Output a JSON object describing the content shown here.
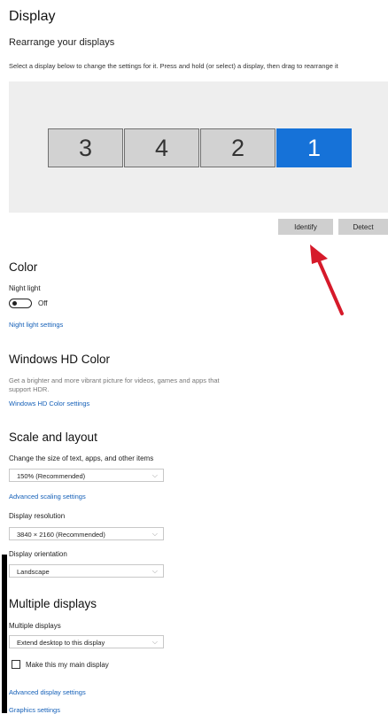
{
  "display": {
    "title": "Display",
    "rearrange_title": "Rearrange your displays",
    "instruction": "Select a display below to change the settings for it. Press and hold (or select) a display, then drag to rearrange it",
    "monitors": [
      "3",
      "4",
      "2",
      "1"
    ],
    "selected_monitor": "1",
    "identify_label": "Identify",
    "detect_label": "Detect"
  },
  "color": {
    "title": "Color",
    "night_light_label": "Night light",
    "night_light_state": "Off",
    "night_light_settings_link": "Night light settings"
  },
  "hd_color": {
    "title": "Windows HD Color",
    "description_line1": "Get a brighter and more vibrant picture for videos, games and apps that",
    "description_line2": "support HDR.",
    "settings_link": "Windows HD Color settings"
  },
  "scale": {
    "title": "Scale and layout",
    "size_label": "Change the size of text, apps, and other items",
    "size_value": "150% (Recommended)",
    "advanced_scaling_link": "Advanced scaling settings",
    "resolution_label": "Display resolution",
    "resolution_value": "3840 × 2160 (Recommended)",
    "orientation_label": "Display orientation",
    "orientation_value": "Landscape"
  },
  "multiple": {
    "title": "Multiple displays",
    "label": "Multiple displays",
    "value": "Extend desktop to this display",
    "main_display_label": "Make this my main display",
    "advanced_display_link": "Advanced display settings",
    "graphics_link": "Graphics settings"
  },
  "colors": {
    "accent": "#1672d8",
    "link": "#1560b8",
    "annotation_arrow": "#d61a2a"
  }
}
